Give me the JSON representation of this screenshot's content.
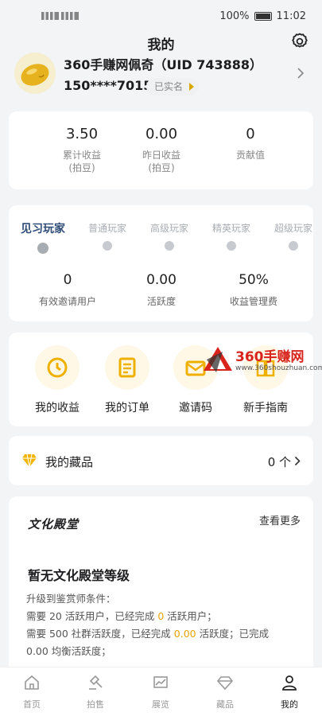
{
  "status_bar": {
    "signal_left": "4G",
    "battery": "100%",
    "time": "11:02"
  },
  "header": {
    "title": "我的"
  },
  "profile": {
    "nickname": "360手赚网佩奇（UID 743888）",
    "phone": "150****7015",
    "verified": "已实名"
  },
  "stats": [
    {
      "value": "3.50",
      "label": "累计收益\n(拍豆)"
    },
    {
      "value": "0.00",
      "label": "昨日收益\n(拍豆)"
    },
    {
      "value": "0",
      "label": "贡献值"
    }
  ],
  "levels": {
    "tiers": [
      "见习玩家",
      "普通玩家",
      "高级玩家",
      "精英玩家",
      "超级玩家"
    ],
    "current": "见习玩家",
    "stats": [
      {
        "value": "0",
        "label": "有效邀请用户"
      },
      {
        "value": "0.00",
        "label": "活跃度"
      },
      {
        "value": "50%",
        "label": "收益管理费"
      }
    ]
  },
  "menu": [
    {
      "label": "我的收益",
      "icon": "earnings-icon"
    },
    {
      "label": "我的订单",
      "icon": "orders-icon"
    },
    {
      "label": "邀请码",
      "icon": "invite-icon"
    },
    {
      "label": "新手指南",
      "icon": "guide-icon"
    }
  ],
  "collection": {
    "label": "我的藏品",
    "count": "0 个"
  },
  "culture": {
    "logo": "文化殿堂",
    "more": "查看更多",
    "level_title": "暂无文化殿堂等级",
    "cond_title": "升级到鉴赏师条件：",
    "cond1_a": "需要 20 活跃用户，已经完成 ",
    "cond1_v": "0",
    "cond1_b": " 活跃用户；",
    "cond2_a": "需要 500 社群活跃度，已经完成 ",
    "cond2_v": "0.00",
    "cond2_b": " 活跃度；已完成",
    "cond3": "0.00 均衡活跃度；"
  },
  "tabbar": [
    {
      "label": "首页",
      "icon": "home-icon"
    },
    {
      "label": "拍售",
      "icon": "auction-icon"
    },
    {
      "label": "展览",
      "icon": "exhibition-icon"
    },
    {
      "label": "藏品",
      "icon": "collection-icon"
    },
    {
      "label": "我的",
      "icon": "profile-icon"
    }
  ],
  "watermark": {
    "text": "360手赚网",
    "sub": "www.360shouzhuan.com"
  },
  "colors": {
    "accent": "#e7a300",
    "level_active": "#2f4c77",
    "background": "#f3f4f6"
  }
}
